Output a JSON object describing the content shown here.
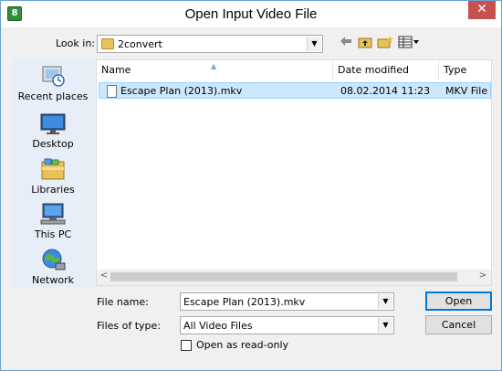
{
  "window": {
    "title": "Open Input Video File",
    "close_glyph": "✕",
    "icon": "app-icon",
    "icon_glyph": "8"
  },
  "lookin": {
    "label": "Look in:",
    "value": "2convert",
    "icon": "folder-icon"
  },
  "toolbar": {
    "back_icon": "back-arrow-icon",
    "up_icon": "up-folder-icon",
    "new_folder_icon": "new-folder-icon",
    "view_menu_icon": "view-menu-icon"
  },
  "places": [
    {
      "label": "Recent places",
      "icon": "recent-places-icon"
    },
    {
      "label": "Desktop",
      "icon": "desktop-icon"
    },
    {
      "label": "Libraries",
      "icon": "libraries-icon"
    },
    {
      "label": "This PC",
      "icon": "this-pc-icon"
    },
    {
      "label": "Network",
      "icon": "network-icon"
    }
  ],
  "filelist": {
    "columns": [
      "Name",
      "Date modified",
      "Type"
    ],
    "rows": [
      {
        "name": "Escape Plan (2013).mkv",
        "date": "08.02.2014 11:23",
        "type": "MKV File"
      }
    ]
  },
  "form": {
    "filename_label": "File name:",
    "filename_value": "Escape Plan (2013).mkv",
    "filetype_label": "Files of type:",
    "filetype_value": "All Video Files",
    "readonly_label": "Open as read-only",
    "readonly_checked": false
  },
  "buttons": {
    "open": "Open",
    "cancel": "Cancel"
  },
  "colors": {
    "selection": "#cce8ff",
    "close_button": "#c75050",
    "window_border": "#6aa1d6"
  }
}
